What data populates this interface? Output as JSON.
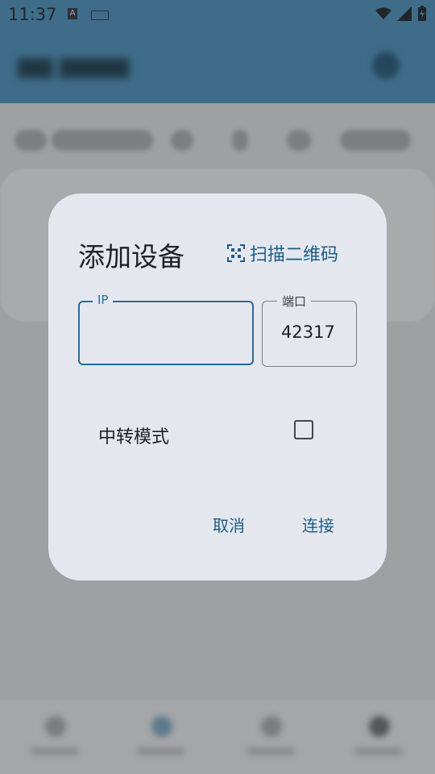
{
  "status": {
    "time": "11:37",
    "a_badge": "A"
  },
  "dialog": {
    "title": "添加设备",
    "scan_label": "扫描二维码",
    "ip": {
      "label": "IP",
      "value": ""
    },
    "port": {
      "label": "端口",
      "value": "42317"
    },
    "relay": {
      "label": "中转模式",
      "checked": false
    },
    "actions": {
      "cancel": "取消",
      "connect": "连接"
    }
  },
  "colors": {
    "accent": "#1e5b86",
    "dialog_background": "#e4e8ee",
    "scrim": "#9fa0a1",
    "appbar": "#3f6d89"
  }
}
